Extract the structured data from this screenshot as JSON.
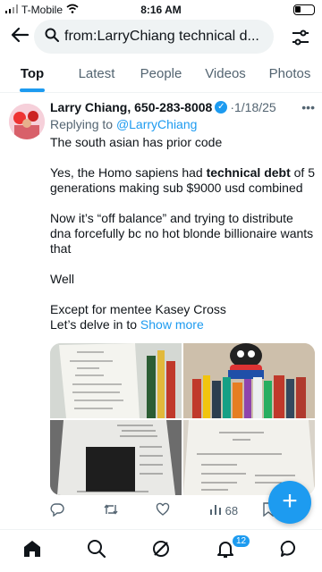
{
  "status_bar": {
    "carrier": "T-Mobile",
    "time": "8:16 AM"
  },
  "search": {
    "query": "from:LarryChiang technical d..."
  },
  "tabs": [
    {
      "label": "Top",
      "active": true
    },
    {
      "label": "Latest",
      "active": false
    },
    {
      "label": "People",
      "active": false
    },
    {
      "label": "Videos",
      "active": false
    },
    {
      "label": "Photos",
      "active": false
    }
  ],
  "tweet": {
    "author": "Larry Chiang, 650-283-8008",
    "date": "1/18/25",
    "replying_prefix": "Replying to ",
    "replying_handle": "@LarryChiang",
    "para1": "The south asian has prior code",
    "para2_pre": "Yes, the Homo sapiens had ",
    "para2_bold": "technical debt",
    "para2_post": " of 5 generations making sub $9000 usd combined",
    "para3": "Now it’s “off balance” and trying to distribute dna forcefully bc no hot blonde billionaire wants that",
    "para4": "Well",
    "para5_line1": "Except for mentee Kasey Cross",
    "para5_line2": "Let’s delve in to ",
    "show_more": "Show more",
    "views": "68"
  },
  "notifications_count": "12",
  "colors": {
    "accent": "#1d9bf0",
    "text": "#0f1419",
    "muted": "#536471"
  },
  "icons": [
    "back-arrow-icon",
    "search-icon",
    "filter-icon",
    "verified-icon",
    "more-icon",
    "reply-icon",
    "retweet-icon",
    "like-icon",
    "views-icon",
    "bookmark-icon",
    "compose-icon",
    "home-icon",
    "explore-icon",
    "grok-icon",
    "notifications-icon",
    "messages-icon"
  ]
}
